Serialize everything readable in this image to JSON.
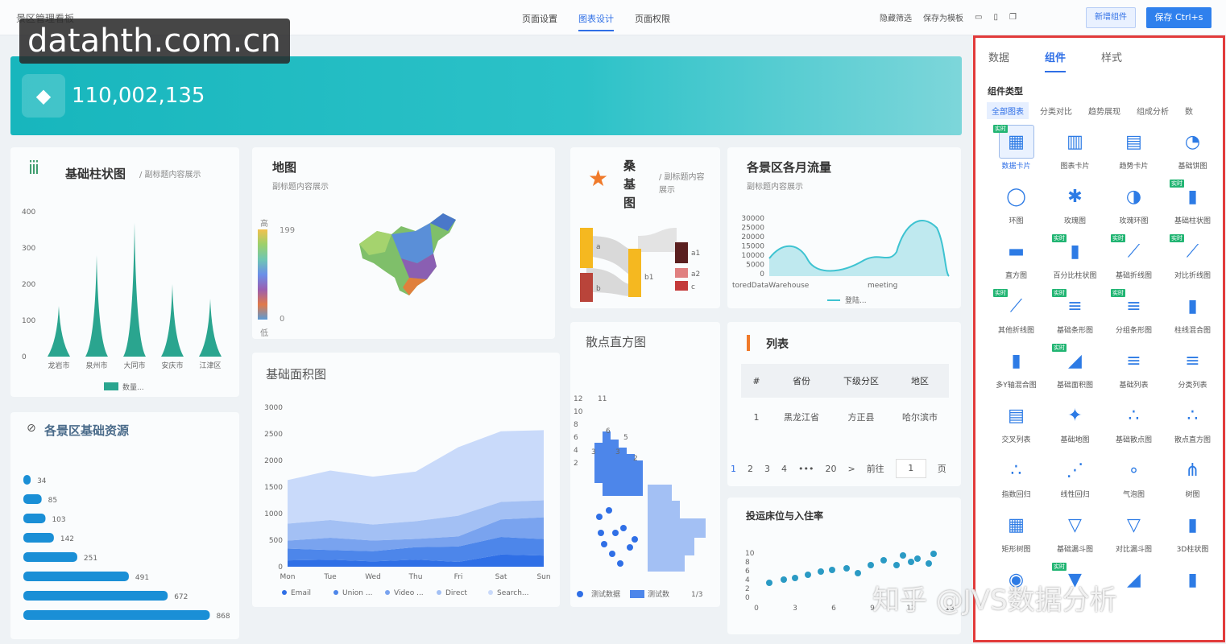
{
  "topbar": {
    "title": "景区管理看板",
    "nav": [
      "页面设置",
      "图表设计",
      "页面权限"
    ],
    "right": [
      "隐藏筛选",
      "保存为模板"
    ],
    "add_btn": "新增组件",
    "save_btn": "保存 Ctrl+s"
  },
  "watermark": "datahth.com.cn",
  "banner": {
    "value": "110,002,135"
  },
  "bar_card": {
    "title": "基础柱状图",
    "subtitle": "/ 副标题内容展示",
    "legend": "数量..."
  },
  "map_card": {
    "title": "地图",
    "subtitle": "副标题内容展示",
    "legend_high": "高",
    "legend_low": "低",
    "max": "199",
    "min": "0"
  },
  "sankey_card": {
    "title": "桑基图",
    "subtitle": "/ 副标题内容展示",
    "nodes": [
      "a",
      "b",
      "b1",
      "a1",
      "a2",
      "c"
    ]
  },
  "flow_card": {
    "title": "各景区各月流量",
    "subtitle": "副标题内容展示",
    "x_labels": [
      "toredDataWarehouse",
      "meeting"
    ],
    "legend": "登陆..."
  },
  "res_card": {
    "title": "各景区基础资源"
  },
  "area_card": {
    "title": "基础面积图",
    "legend": [
      "Email",
      "Union ...",
      "Video ...",
      "Direct",
      "Search..."
    ]
  },
  "scatter_hist_card": {
    "title": "散点直方图",
    "legend": [
      "测试数据",
      "测试数"
    ],
    "pager": "1/3"
  },
  "list_card": {
    "title": "列表",
    "headers": [
      "#",
      "省份",
      "下级分区",
      "地区"
    ],
    "row": [
      "1",
      "黑龙江省",
      "方正县",
      "哈尔滨市"
    ],
    "pages": [
      "1",
      "2",
      "3",
      "4",
      "•••",
      "20",
      ">"
    ],
    "goto": "前往",
    "page_input": "1",
    "page_unit": "页"
  },
  "bed_card": {
    "title": "投运床位与入住率"
  },
  "right_panel": {
    "tabs": [
      "数据",
      "组件",
      "样式"
    ],
    "label": "组件类型",
    "filters": [
      "全部图表",
      "分类对比",
      "趋势展现",
      "组成分析",
      "数"
    ],
    "tag": "实时",
    "items": [
      "数据卡片",
      "图表卡片",
      "趋势卡片",
      "基础饼图",
      "环图",
      "玫瑰图",
      "玫瑰环图",
      "基础柱状图",
      "直方图",
      "百分比柱状图",
      "基础折线图",
      "对比折线图",
      "其他折线图",
      "基础条形图",
      "分组条形图",
      "柱线混合图",
      "多Y轴混合图",
      "基础面积图",
      "基础列表",
      "分类列表",
      "交叉列表",
      "基础地图",
      "基础散点图",
      "散点直方图",
      "指数回归",
      "线性回归",
      "气泡图",
      "树图",
      "矩形树图",
      "基础漏斗图",
      "对比漏斗图",
      "3D柱状图",
      "",
      "",
      "",
      ""
    ]
  },
  "zh_watermark": "知乎 @JVS数据分析",
  "chart_data": [
    {
      "type": "bar",
      "categories": [
        "龙岩市",
        "泉州市",
        "大同市",
        "安庆市",
        "江津区"
      ],
      "values": [
        140,
        280,
        370,
        200,
        160
      ],
      "ylim": [
        0,
        400
      ],
      "series": [
        {
          "name": "数量...",
          "values": [
            140,
            280,
            370,
            200,
            160
          ]
        }
      ]
    },
    {
      "type": "bar",
      "orientation": "horizontal",
      "values": [
        34,
        85,
        103,
        142,
        251,
        491,
        672,
        868
      ]
    },
    {
      "type": "area",
      "categories": [
        "Mon",
        "Tue",
        "Wed",
        "Thu",
        "Fri",
        "Sat",
        "Sun"
      ],
      "ylim": [
        0,
        3000
      ],
      "series": [
        {
          "name": "Email",
          "values": [
            120,
            132,
            101,
            134,
            90,
            230,
            210
          ]
        },
        {
          "name": "Union ...",
          "values": [
            220,
            182,
            191,
            234,
            290,
            330,
            310
          ]
        },
        {
          "name": "Video ...",
          "values": [
            150,
            232,
            201,
            154,
            190,
            330,
            410
          ]
        },
        {
          "name": "Direct",
          "values": [
            320,
            332,
            301,
            334,
            390,
            330,
            320
          ]
        },
        {
          "name": "Search...",
          "values": [
            820,
            932,
            901,
            934,
            1290,
            1330,
            1320
          ]
        }
      ]
    },
    {
      "type": "line",
      "x": [
        "toredDataWarehouse",
        "meeting"
      ],
      "ylim": [
        0,
        30000
      ]
    },
    {
      "type": "scatter",
      "xlim": [
        0,
        15
      ],
      "ylim": [
        0,
        10
      ]
    }
  ]
}
